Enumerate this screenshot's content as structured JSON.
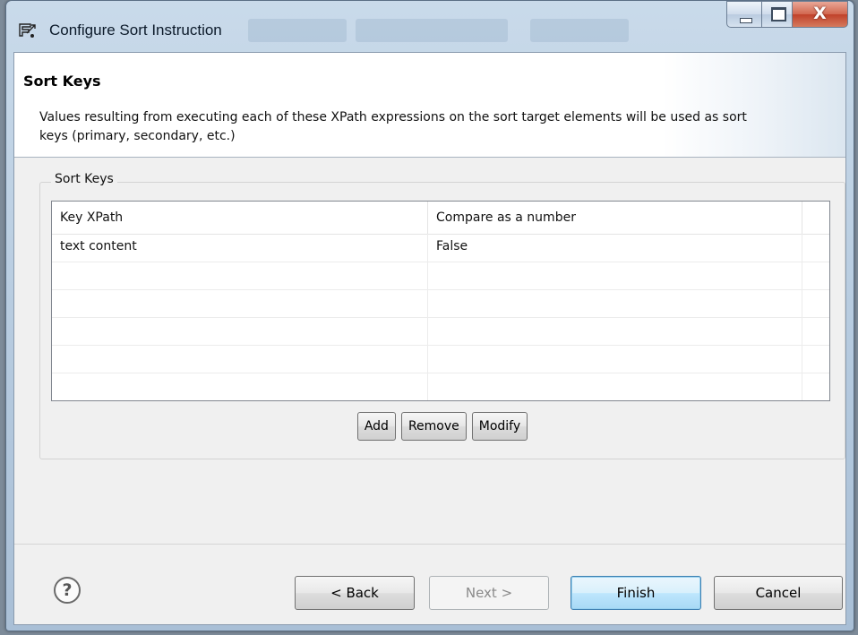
{
  "window": {
    "title": "Configure Sort Instruction",
    "close_symbol": "X"
  },
  "banner": {
    "title": "Sort Keys",
    "description": "Values resulting from executing each of these XPath expressions on the sort target elements will be used as sort keys (primary, secondary, etc.)"
  },
  "group": {
    "legend": "Sort Keys"
  },
  "table": {
    "columns": [
      "Key XPath",
      "Compare as a number"
    ],
    "rows": [
      [
        "text content",
        "False"
      ],
      [
        "",
        ""
      ],
      [
        "",
        ""
      ],
      [
        "",
        ""
      ],
      [
        "",
        ""
      ],
      [
        "",
        ""
      ]
    ]
  },
  "buttons": {
    "add": "Add",
    "remove": "Remove",
    "modify": "Modify"
  },
  "footer": {
    "help_symbol": "?",
    "back": "< Back",
    "next": "Next >",
    "finish": "Finish",
    "cancel": "Cancel"
  },
  "icons": {
    "title_icon": "eclipse-wizard-icon",
    "help": "help-icon",
    "minimize": "minimize-icon",
    "maximize": "maximize-icon",
    "close": "close-icon"
  },
  "colors": {
    "default_button": "#bee6fd",
    "titlebar": "#b4c9de"
  }
}
